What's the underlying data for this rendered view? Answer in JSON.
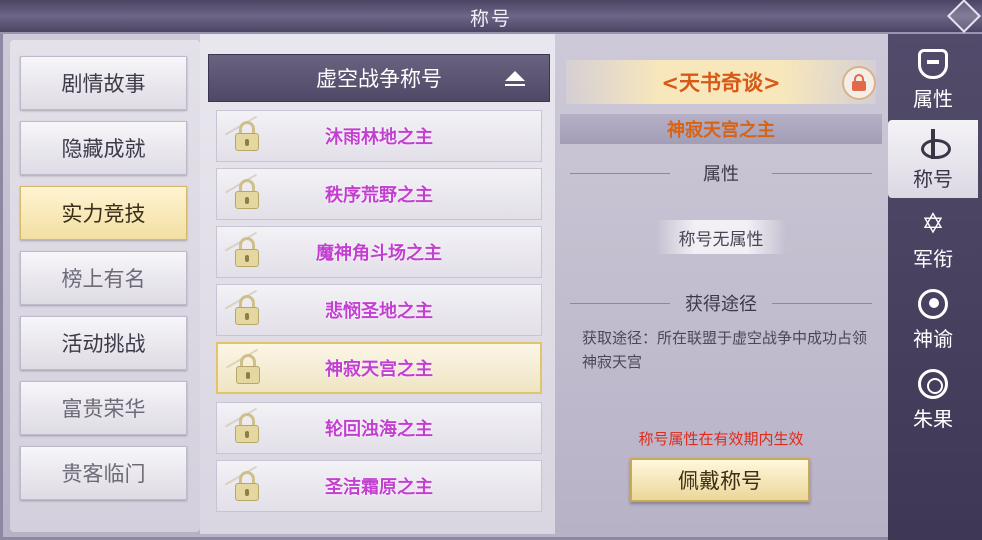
{
  "window": {
    "title": "称号"
  },
  "left_tabs": [
    {
      "label": "剧情故事",
      "state": "normal"
    },
    {
      "label": "隐藏成就",
      "state": "normal"
    },
    {
      "label": "实力竞技",
      "state": "active"
    },
    {
      "label": "榜上有名",
      "state": "dim"
    },
    {
      "label": "活动挑战",
      "state": "normal"
    },
    {
      "label": "富贵荣华",
      "state": "dim"
    },
    {
      "label": "贵客临门",
      "state": "dim"
    }
  ],
  "title_list": {
    "header": "虚空战争称号",
    "items": [
      {
        "name": "沐雨林地之主",
        "locked": true,
        "selected": false
      },
      {
        "name": "秩序荒野之主",
        "locked": true,
        "selected": false
      },
      {
        "name": "魔神角斗场之主",
        "locked": true,
        "selected": false
      },
      {
        "name": "悲悯圣地之主",
        "locked": true,
        "selected": false
      },
      {
        "name": "神寂天宫之主",
        "locked": true,
        "selected": true
      },
      {
        "name": "轮回浊海之主",
        "locked": true,
        "selected": false
      },
      {
        "name": "圣洁霜原之主",
        "locked": true,
        "selected": false
      }
    ]
  },
  "detail": {
    "banner": "<天书奇谈>",
    "title_name": "神寂天宫之主",
    "attr_header": "属性",
    "attr_value": "称号无属性",
    "acquire_header": "获得途径",
    "acquire_text": "获取途径：所在联盟于虚空战争中成功占领神寂天宫",
    "notice": "称号属性在有效期内生效",
    "wear_button": "佩戴称号"
  },
  "right_nav": [
    {
      "label": "属性",
      "icon": "mask-icon",
      "active": false
    },
    {
      "label": "称号",
      "icon": "sword-icon",
      "active": true
    },
    {
      "label": "军衔",
      "icon": "star-icon",
      "active": false
    },
    {
      "label": "神谕",
      "icon": "moon-icon",
      "active": false
    },
    {
      "label": "朱果",
      "icon": "fruit-icon",
      "active": false
    }
  ],
  "colors": {
    "title_purple": "#c23fd0",
    "detail_orange": "#d86312",
    "notice_red": "#e02a1a",
    "active_gold": "#f3dfa4"
  }
}
